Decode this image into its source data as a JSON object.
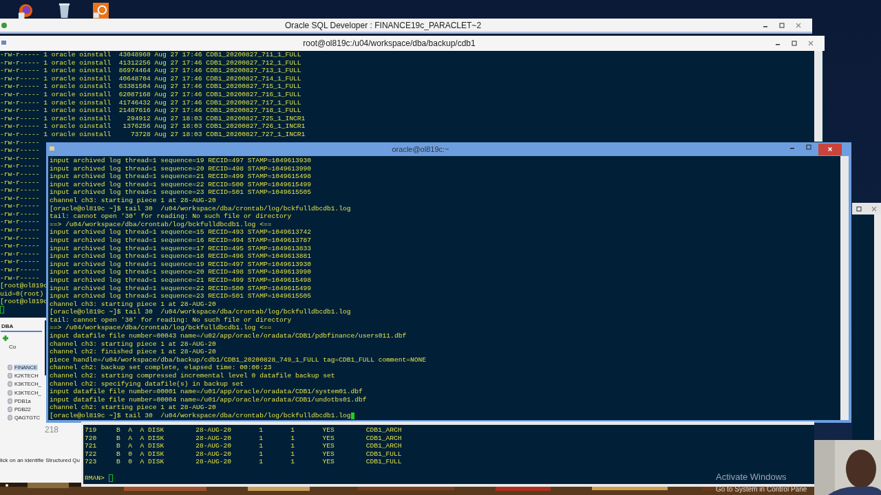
{
  "sql_developer": {
    "title": "Oracle SQL Developer : FINANCE19c_PARACLET~2",
    "tabs": [
      {
        "label": "DBA",
        "selected": true
      }
    ],
    "column_header": "Co",
    "tree": [
      {
        "label": "FINANCE",
        "selected": true
      },
      {
        "label": "K2KTECH",
        "selected": false
      },
      {
        "label": "K3KTECH_",
        "selected": false
      },
      {
        "label": "K3KTECH_",
        "selected": false
      },
      {
        "label": "PDB1a",
        "selected": false
      },
      {
        "label": "PDB22",
        "selected": false
      },
      {
        "label": "QAGTGTC",
        "selected": false
      }
    ],
    "line_number": "218",
    "status": "lick on an identifie",
    "bottom_tab": "Structured Qu"
  },
  "root_terminal": {
    "title": "root@ol819c:/u04/workspace/dba/backup/cdb1",
    "lines": [
      "-rw-r----- 1 oracle oinstall  43048960 Aug 27 17:46 CDB1_20200827_711_1_FULL",
      "-rw-r----- 1 oracle oinstall  41312256 Aug 27 17:46 CDB1_20200827_712_1_FULL",
      "-rw-r----- 1 oracle oinstall  86974464 Aug 27 17:46 CDB1_20200827_713_1_FULL",
      "-rw-r----- 1 oracle oinstall  40648704 Aug 27 17:46 CDB1_20200827_714_1_FULL",
      "-rw-r----- 1 oracle oinstall  63381504 Aug 27 17:46 CDB1_20200827_715_1_FULL",
      "-rw-r----- 1 oracle oinstall  62087168 Aug 27 17:46 CDB1_20200827_716_1_FULL",
      "-rw-r----- 1 oracle oinstall  41746432 Aug 27 17:46 CDB1_20200827_717_1_FULL",
      "-rw-r----- 1 oracle oinstall  21487616 Aug 27 17:46 CDB1_20200827_718_1_FULL",
      "-rw-r----- 1 oracle oinstall    294912 Aug 27 18:03 CDB1_20200827_725_1_INCR1",
      "-rw-r----- 1 oracle oinstall   1376256 Aug 27 18:03 CDB1_20200827_726_1_INCR1",
      "-rw-r----- 1 oracle oinstall     73728 Aug 27 18:03 CDB1_20200827_727_1_INCR1",
      "-rw-r-----",
      "-rw-r-----",
      "-rw-r-----",
      "-rw-r-----",
      "-rw-r-----",
      "-rw-r-----",
      "-rw-r-----",
      "-rw-r-----",
      "-rw-r-----",
      "-rw-r-----",
      "-rw-r-----",
      "-rw-r-----",
      "-rw-r-----",
      "-rw-r-----",
      "-rw-r-----",
      "-rw-r-----",
      "-rw-r-----",
      "-rw-r-----",
      "[root@ol819c",
      "uid=0(root)",
      "[root@ol819c"
    ]
  },
  "oracle_terminal": {
    "title": "oracle@ol819c:~",
    "lines": [
      "input archived log thread=1 sequence=19 RECID=497 STAMP=1049613930",
      "input archived log thread=1 sequence=20 RECID=498 STAMP=1049613990",
      "input archived log thread=1 sequence=21 RECID=499 STAMP=1049615498",
      "input archived log thread=1 sequence=22 RECID=500 STAMP=1049615499",
      "input archived log thread=1 sequence=23 RECID=501 STAMP=1049615505",
      "channel ch3: starting piece 1 at 28-AUG-20",
      "[oracle@ol819c ~]$ tail 30  /u04/workspace/dba/crontab/log/bckfulldbcdb1.log",
      "tail: cannot open '30' for reading: No such file or directory",
      "==> /u04/workspace/dba/crontab/log/bckfulldbcdb1.log <==",
      "input archived log thread=1 sequence=15 RECID=493 STAMP=1049613742",
      "input archived log thread=1 sequence=16 RECID=494 STAMP=1049613787",
      "input archived log thread=1 sequence=17 RECID=495 STAMP=1049613833",
      "input archived log thread=1 sequence=18 RECID=496 STAMP=1049613881",
      "input archived log thread=1 sequence=19 RECID=497 STAMP=1049613930",
      "input archived log thread=1 sequence=20 RECID=498 STAMP=1049613990",
      "input archived log thread=1 sequence=21 RECID=499 STAMP=1049615498",
      "input archived log thread=1 sequence=22 RECID=500 STAMP=1049615499",
      "input archived log thread=1 sequence=23 RECID=501 STAMP=1049615505",
      "channel ch3: starting piece 1 at 28-AUG-20",
      "[oracle@ol819c ~]$ tail 30  /u04/workspace/dba/crontab/log/bckfulldbcdb1.log",
      "tail: cannot open '30' for reading: No such file or directory",
      "==> /u04/workspace/dba/crontab/log/bckfulldbcdb1.log <==",
      "input datafile file number=00043 name=/u02/app/oracle/oradata/CDB1/pdbfinance/users011.dbf",
      "channel ch3: starting piece 1 at 28-AUG-20",
      "channel ch2: finished piece 1 at 28-AUG-20",
      "piece handle=/u04/workspace/dba/backup/cdb1/CDB1_20200828_749_1_FULL tag=CDB1_FULL comment=NONE",
      "channel ch2: backup set complete, elapsed time: 00:00:23",
      "channel ch2: starting compressed incremental level 0 datafile backup set",
      "channel ch2: specifying datafile(s) in backup set",
      "input datafile file number=00001 name=/u01/app/oracle/oradata/CDB1/system01.dbf",
      "input datafile file number=00004 name=/u01/app/oracle/oradata/CDB1/undotbs01.dbf",
      "channel ch2: starting piece 1 at 28-AUG-20",
      "[oracle@ol819c ~]$ tail 30  /u04/workspace/dba/crontab/log/bckfulldbcdb1.log"
    ]
  },
  "rman_terminal": {
    "lines": [
      "719     B  A  A DISK        28-AUG-20       1       1       YES        CDB1_ARCH",
      "720     B  A  A DISK        28-AUG-20       1       1       YES        CDB1_ARCH",
      "721     B  A  A DISK        28-AUG-20       1       1       YES        CDB1_ARCH",
      "722     B  0  A DISK        28-AUG-20       1       1       YES        CDB1_FULL",
      "723     B  0  A DISK        28-AUG-20       1       1       YES        CDB1_FULL"
    ],
    "prompt": "RMAN>"
  },
  "activation_notice": {
    "title": "Activate Windows",
    "text": "Go to System in Control Pane"
  }
}
